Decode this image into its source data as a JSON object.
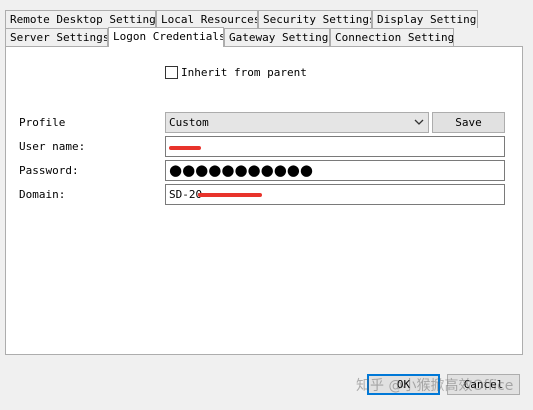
{
  "tabs_row1": [
    {
      "label": "Remote Desktop Settings"
    },
    {
      "label": "Local Resources"
    },
    {
      "label": "Security Settings"
    },
    {
      "label": "Display Settings"
    }
  ],
  "tabs_row2": [
    {
      "label": "Server Settings"
    },
    {
      "label": "Logon Credentials",
      "active": true
    },
    {
      "label": "Gateway Settings"
    },
    {
      "label": "Connection Settings"
    }
  ],
  "form": {
    "inherit_label": "Inherit from parent",
    "inherit_checked": false,
    "profile_label": "Profile",
    "profile_value": "Custom",
    "save_label": "Save",
    "username_label": "User name:",
    "username_value": "",
    "password_label": "Password:",
    "password_value": "●●●●●●●●●●●",
    "domain_label": "Domain:",
    "domain_value": "SD-20"
  },
  "footer": {
    "ok_label": "OK",
    "cancel_label": "Cancel"
  },
  "watermark": "知乎 @小猴掀高效Office",
  "colors": {
    "redaction": "#e8332b",
    "focus_border": "#0078d7"
  }
}
